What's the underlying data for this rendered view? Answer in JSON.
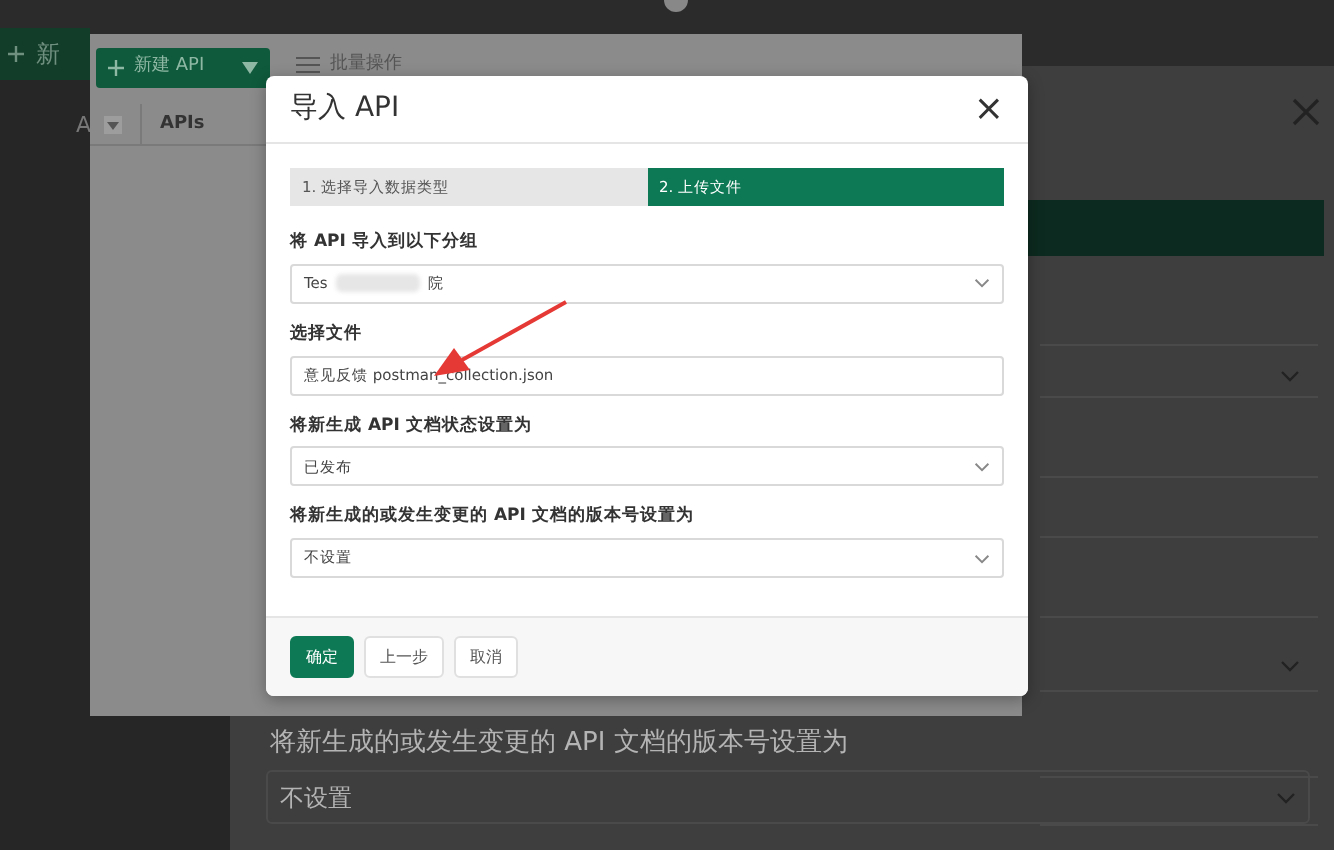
{
  "background_app": {
    "new_button": {
      "label": "新"
    },
    "column_heading": "A",
    "section_label": "将新生成的或发生变更的 API 文档的版本号设置为",
    "section_value": "不设置"
  },
  "underlying_page": {
    "new_button": {
      "label": "新建 API"
    },
    "batch_action": {
      "label": "批量操作"
    },
    "table": {
      "columns": [
        "APIs"
      ]
    }
  },
  "dialog": {
    "title": "导入 API",
    "close": "×",
    "steps": [
      {
        "label": "1. 选择导入数据类型",
        "selected": false
      },
      {
        "label": "2. 上传文件",
        "selected": true
      }
    ],
    "fields": [
      {
        "kind": "select",
        "label": "将 API 导入到以下分组",
        "value": "Tes",
        "value_end": "院"
      },
      {
        "kind": "file",
        "label": "选择文件",
        "value": "意见反馈 postman_collection.json"
      },
      {
        "kind": "select",
        "label": "将新生成 API 文档状态设置为",
        "value": "已发布"
      },
      {
        "kind": "select",
        "label": "将新生成的或发生变更的 API 文档的版本号设置为",
        "value": "不设置"
      }
    ],
    "buttons": [
      {
        "label": "确定",
        "kind": "primary"
      },
      {
        "label": "上一步",
        "kind": "secondary"
      },
      {
        "label": "取消",
        "kind": "secondary"
      }
    ]
  }
}
